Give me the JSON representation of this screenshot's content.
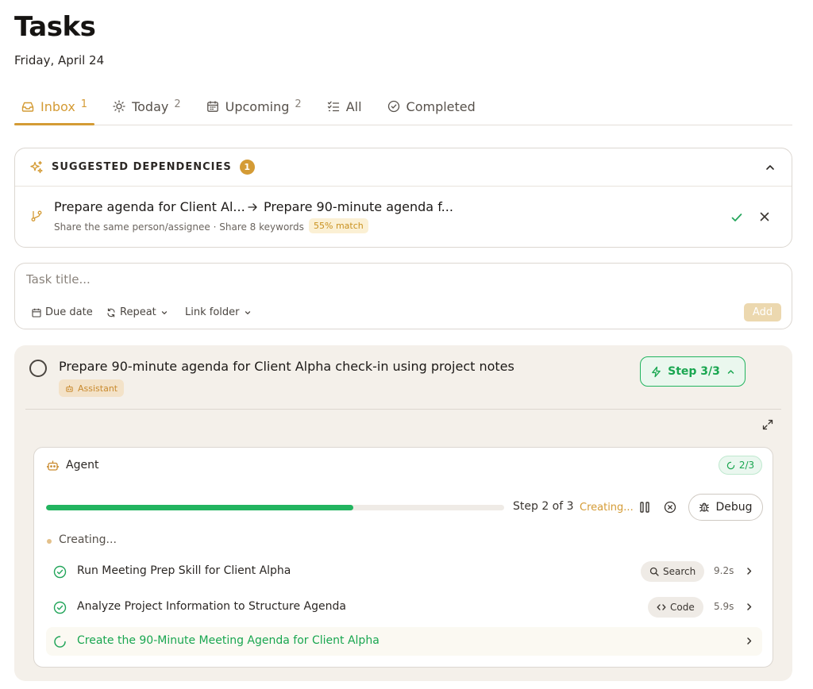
{
  "page": {
    "title": "Tasks",
    "date": "Friday, April 24"
  },
  "tabs": [
    {
      "label": "Inbox",
      "count": "1",
      "icon": "inbox-icon",
      "active": true
    },
    {
      "label": "Today",
      "count": "2",
      "icon": "sun-icon"
    },
    {
      "label": "Upcoming",
      "count": "2",
      "icon": "calendar-icon"
    },
    {
      "label": "All",
      "count": "",
      "icon": "list-check-icon"
    },
    {
      "label": "Completed",
      "count": "",
      "icon": "circle-check-icon"
    }
  ],
  "suggestions": {
    "title": "SUGGESTED DEPENDENCIES",
    "count": "1",
    "items": [
      {
        "from": "Prepare agenda for Client Al...",
        "to": "Prepare 90-minute agenda f...",
        "reason": "Share the same person/assignee · Share 8 keywords",
        "match": "55% match"
      }
    ]
  },
  "new_task": {
    "placeholder": "Task title...",
    "due_date": "Due date",
    "repeat": "Repeat",
    "link_folder": "Link folder",
    "add": "Add"
  },
  "task": {
    "title": "Prepare 90-minute agenda for Client Alpha check-in using project notes",
    "badge": "Assistant",
    "step_button": "Step 3/3",
    "agent": {
      "label": "Agent",
      "progress_badge": "2/3",
      "progress": 0.67,
      "step_label": "Step 2 of 3",
      "state_label": "Creating...",
      "debug": "Debug",
      "status": "Creating...",
      "steps": [
        {
          "title": "Run Meeting Prep Skill for Client Alpha",
          "tool": "Search",
          "tool_icon": "search-icon",
          "duration": "9.2s",
          "status": "done"
        },
        {
          "title": "Analyze Project Information to Structure Agenda",
          "tool": "Code",
          "tool_icon": "code-icon",
          "duration": "5.9s",
          "status": "done"
        },
        {
          "title": "Create the 90-Minute Meeting Agenda for Client Alpha",
          "tool": "",
          "duration": "",
          "status": "running"
        }
      ]
    }
  },
  "colors": {
    "accent": "#d49b35",
    "success": "#22b45f",
    "panel": "#f4f0ea"
  }
}
